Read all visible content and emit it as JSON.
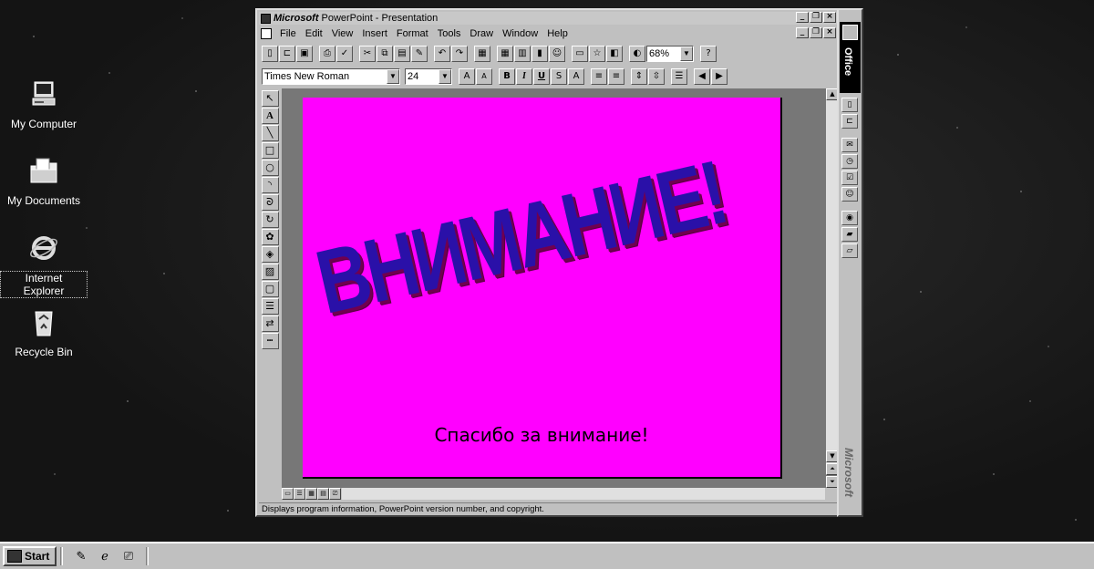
{
  "desktop": {
    "icons": [
      {
        "label": "My Computer",
        "icon": "computer-icon"
      },
      {
        "label": "My Documents",
        "icon": "folder-icon"
      },
      {
        "label_line1": "Internet",
        "label_line2": "Explorer",
        "icon": "internet-explorer-icon"
      },
      {
        "label": "Recycle Bin",
        "icon": "recycle-bin-icon"
      }
    ]
  },
  "window": {
    "title_brand": "Microsoft",
    "title_text": "PowerPoint - Presentation",
    "menu": [
      "File",
      "Edit",
      "View",
      "Insert",
      "Format",
      "Tools",
      "Draw",
      "Window",
      "Help"
    ],
    "font_name": "Times New Roman",
    "font_size": "24",
    "zoom": "68%",
    "status_text": "Displays program information, PowerPoint version number, and copyright."
  },
  "slide": {
    "background_color": "#ff00ff",
    "headline": "ВНИМАНИЕ!",
    "headline_color": "#2a10a8",
    "subtitle": "Спасибо за внимание!"
  },
  "office_bar": {
    "label": "Office",
    "vendor": "Microsoft"
  },
  "taskbar": {
    "start_label": "Start"
  }
}
